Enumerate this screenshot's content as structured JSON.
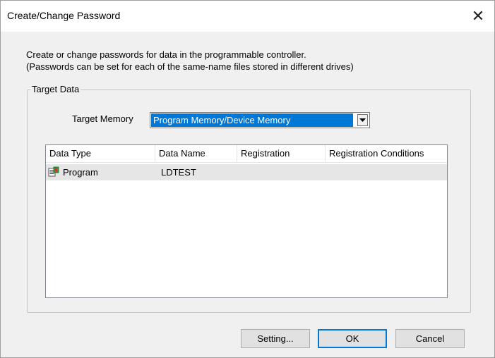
{
  "window": {
    "title": "Create/Change Password",
    "close_glyph": "✕"
  },
  "description": {
    "line1": "Create or change passwords for data in the programmable controller.",
    "line2": "(Passwords can be set for each of the same-name files stored in different drives)"
  },
  "target_data": {
    "group_label": "Target Data",
    "memory_label": "Target Memory",
    "memory_selected": "Program Memory/Device Memory"
  },
  "table": {
    "columns": [
      "Data Type",
      "Data Name",
      "Registration",
      "Registration Conditions"
    ],
    "rows": [
      {
        "data_type": "Program",
        "data_name": "LDTEST",
        "registration": "",
        "conditions": "",
        "icon": "program-icon"
      }
    ]
  },
  "buttons": {
    "setting": "Setting...",
    "ok": "OK",
    "cancel": "Cancel"
  },
  "colors": {
    "selection": "#0078d7",
    "row_highlight": "#e6e6e6",
    "dialog_bg": "#f0f0f0"
  }
}
